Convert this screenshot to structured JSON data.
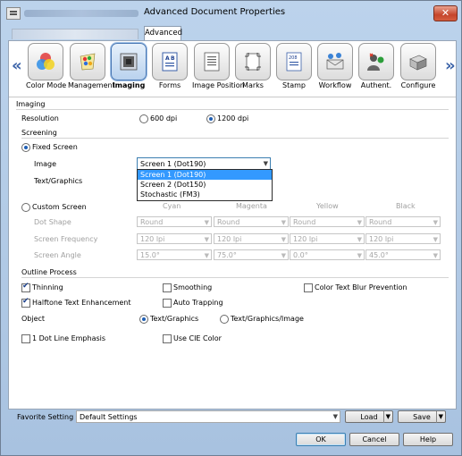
{
  "window": {
    "title": "Advanced Document Properties",
    "close_glyph": "✕"
  },
  "tabs": [
    {
      "label": "Advanced"
    }
  ],
  "nav": {
    "prev": "«",
    "next": "»"
  },
  "functions": [
    {
      "label": "Color Mode",
      "icon": "color-wheel-icon"
    },
    {
      "label": "Management",
      "icon": "palette-icon"
    },
    {
      "label": "Imaging",
      "icon": "imaging-icon",
      "selected": true
    },
    {
      "label": "Forms",
      "icon": "forms-icon"
    },
    {
      "label": "Image Position",
      "icon": "image-position-icon"
    },
    {
      "label": "Marks",
      "icon": "marks-icon"
    },
    {
      "label": "Stamp",
      "icon": "stamp-icon"
    },
    {
      "label": "Workflow",
      "icon": "workflow-icon"
    },
    {
      "label": "Authent.",
      "icon": "authentication-icon"
    },
    {
      "label": "Configure",
      "icon": "configure-icon"
    }
  ],
  "imaging": {
    "section": "Imaging",
    "resolution_label": "Resolution",
    "res_600": "600 dpi",
    "res_1200": "1200 dpi",
    "selected_resolution": "1200 dpi"
  },
  "screening": {
    "section": "Screening",
    "fixed_label": "Fixed Screen",
    "image_label": "Image",
    "image_value": "Screen 1 (Dot190)",
    "textgraphics_label": "Text/Graphics",
    "dropdown_options": [
      "Screen 1 (Dot190)",
      "Screen 2 (Dot150)",
      "Stochastic (FM3)"
    ],
    "custom_label": "Custom Screen",
    "columns": [
      "Cyan",
      "Magenta",
      "Yellow",
      "Black"
    ],
    "rows": [
      {
        "label": "Dot Shape",
        "values": [
          "Round",
          "Round",
          "Round",
          "Round"
        ]
      },
      {
        "label": "Screen Frequency",
        "values": [
          "120 lpi",
          "120 lpi",
          "120 lpi",
          "120 lpi"
        ]
      },
      {
        "label": "Screen Angle",
        "values": [
          "15.0°",
          "75.0°",
          "0.0°",
          "45.0°"
        ]
      }
    ]
  },
  "outline": {
    "section": "Outline Process",
    "thinning": "Thinning",
    "smoothing": "Smoothing",
    "color_text_blur": "Color Text Blur Prevention",
    "halftone": "Halftone Text Enhancement",
    "auto_trapping": "Auto Trapping",
    "object_label": "Object",
    "obj_text_graphics": "Text/Graphics",
    "obj_text_graphics_image": "Text/Graphics/Image",
    "one_dot": "1 Dot Line Emphasis",
    "use_cie": "Use CIE Color"
  },
  "favorite": {
    "label": "Favorite Setting",
    "value": "Default Settings",
    "load": "Load",
    "save": "Save"
  },
  "buttons": {
    "ok": "OK",
    "cancel": "Cancel",
    "help": "Help"
  }
}
